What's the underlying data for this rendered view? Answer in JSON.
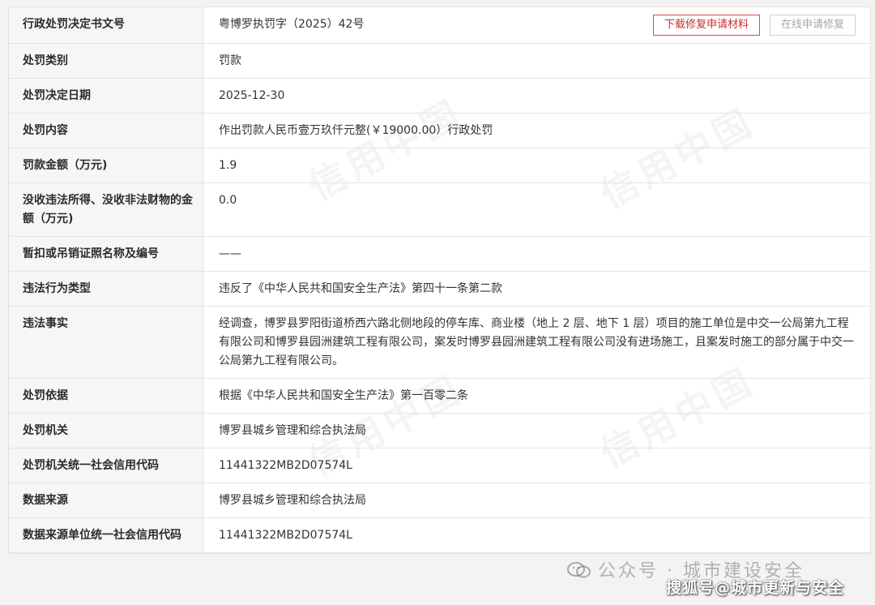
{
  "actions": {
    "download_label": "下载修复申请材料",
    "online_label": "在线申请修复"
  },
  "watermark_text": "信用中国",
  "rows": [
    {
      "key": "行政处罚决定书文号",
      "value": "粤博罗执罚字（2025）42号"
    },
    {
      "key": "处罚类别",
      "value": "罚款"
    },
    {
      "key": "处罚决定日期",
      "value": "2025-12-30"
    },
    {
      "key": "处罚内容",
      "value": "作出罚款人民币壹万玖仟元整(￥19000.00）行政处罚"
    },
    {
      "key": "罚款金额（万元)",
      "value": "1.9"
    },
    {
      "key": "没收违法所得、没收非法财物的金额（万元)",
      "value": "0.0"
    },
    {
      "key": "暂扣或吊销证照名称及编号",
      "value": "——"
    },
    {
      "key": "违法行为类型",
      "value": "违反了《中华人民共和国安全生产法》第四十一条第二款"
    },
    {
      "key": "违法事实",
      "value": "经调查，博罗县罗阳街道桥西六路北侧地段的停车库、商业楼（地上 2 层、地下 1 层）项目的施工单位是中交一公局第九工程有限公司和博罗县园洲建筑工程有限公司，案发时博罗县园洲建筑工程有限公司没有进场施工，且案发时施工的部分属于中交一公局第九工程有限公司。"
    },
    {
      "key": "处罚依据",
      "value": "根据《中华人民共和国安全生产法》第一百零二条"
    },
    {
      "key": "处罚机关",
      "value": "博罗县城乡管理和综合执法局"
    },
    {
      "key": "处罚机关统一社会信用代码",
      "value": "11441322MB2D07574L"
    },
    {
      "key": "数据来源",
      "value": "博罗县城乡管理和综合执法局"
    },
    {
      "key": "数据来源单位统一社会信用代码",
      "value": "11441322MB2D07574L"
    }
  ],
  "footer": {
    "wechat_label": "公众号 · 城市建设安全",
    "sohu_label": "搜狐号@城市更新与安全"
  }
}
